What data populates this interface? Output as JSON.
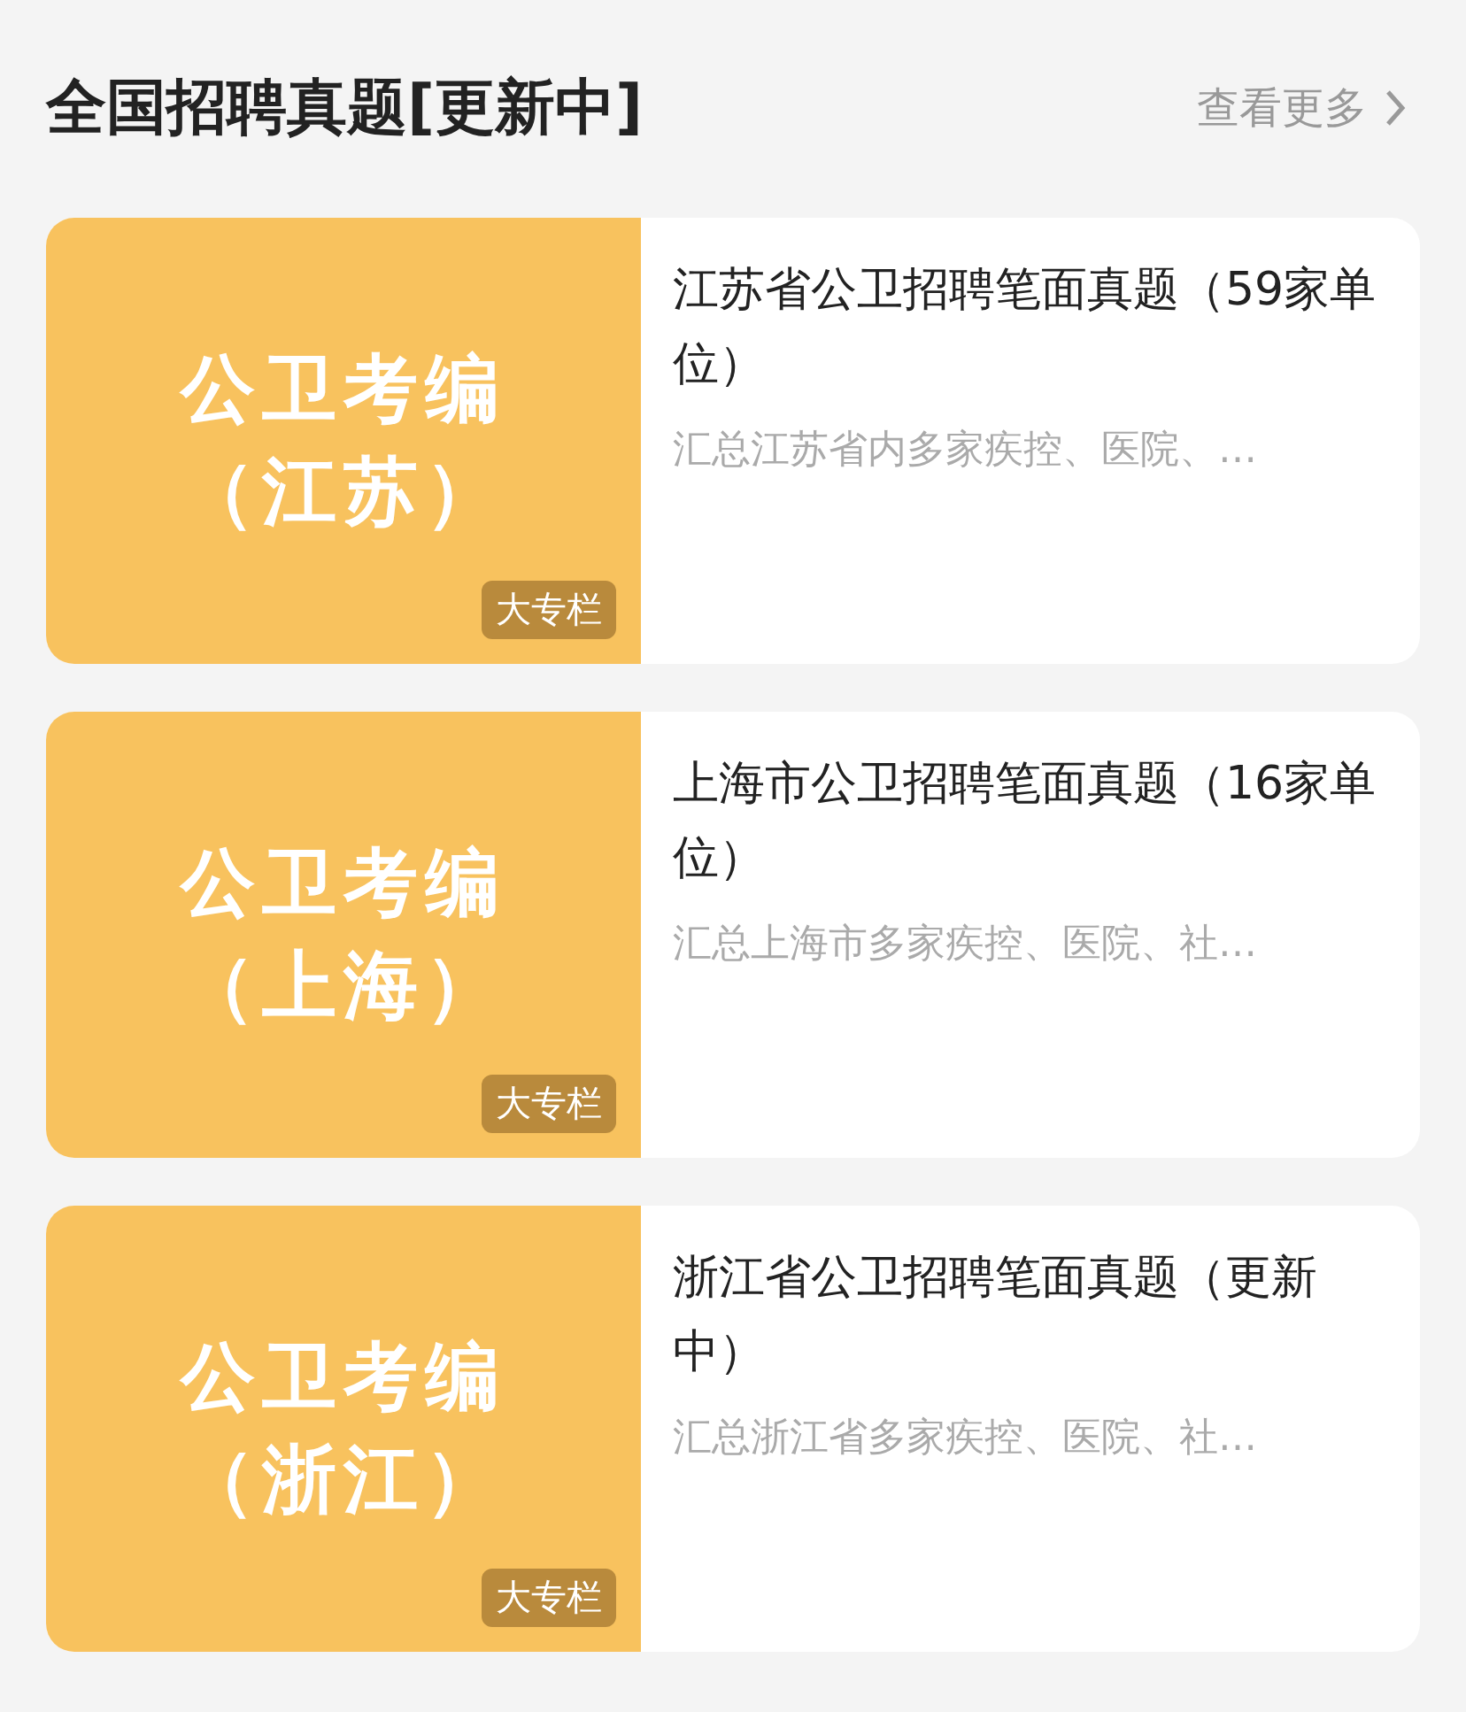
{
  "header": {
    "title": "全国招聘真题[更新中]",
    "more_link": "查看更多"
  },
  "cards": [
    {
      "cover_lines": [
        "公卫考编",
        "（江苏）"
      ],
      "badge": "大专栏",
      "title": "江苏省公卫招聘笔面真题（59家单位）",
      "summary": "汇总江苏省内多家疾控、医院、…"
    },
    {
      "cover_lines": [
        "公卫考编",
        "（上海）"
      ],
      "badge": "大专栏",
      "title": "上海市公卫招聘笔面真题（16家单位）",
      "summary": "汇总上海市多家疾控、医院、社…"
    },
    {
      "cover_lines": [
        "公卫考编",
        "（浙江）"
      ],
      "badge": "大专栏",
      "title": "浙江省公卫招聘笔面真题（更新中）",
      "summary": "汇总浙江省多家疾控、医院、社…"
    }
  ]
}
